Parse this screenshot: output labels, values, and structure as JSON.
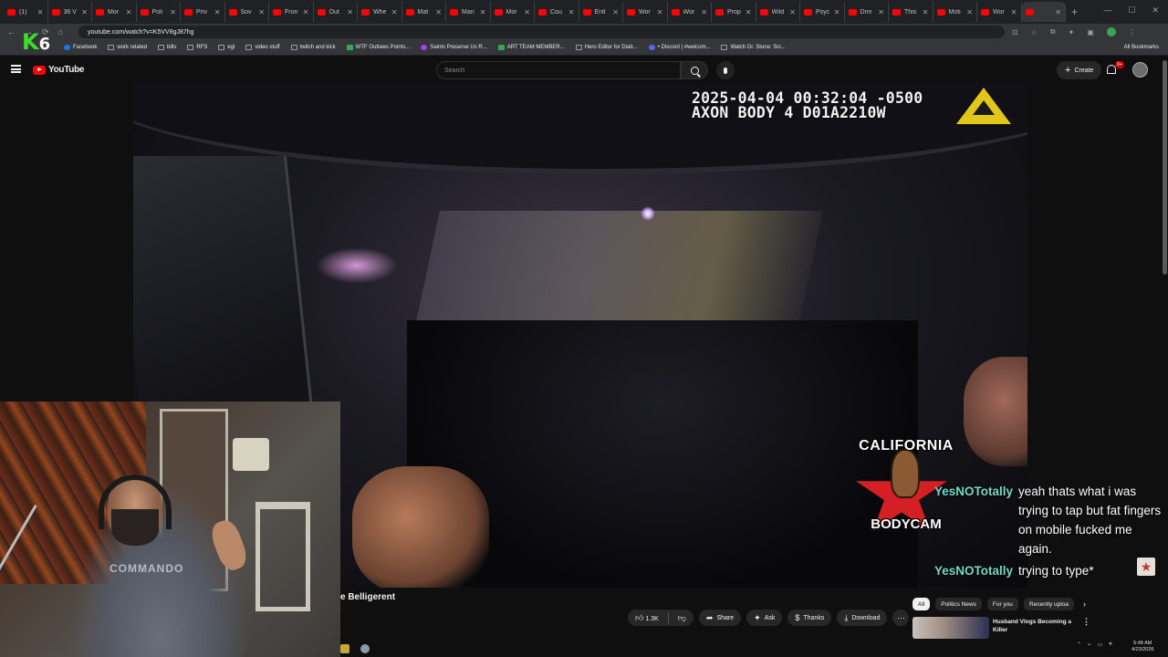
{
  "browser": {
    "tabs": [
      "(1)",
      "36 V",
      "Mor",
      "Poli",
      "Priv",
      "Sov",
      "Fron",
      "Out",
      "Whe",
      "Mat",
      "Man",
      "Mor",
      "Cou",
      "Entl",
      "Wor",
      "Wor",
      "Prop",
      "Wild",
      "Psyc",
      "Drin",
      "This",
      "Moti",
      "Wor"
    ],
    "active_tab": "",
    "url": "youtube.com/watch?v=K5VV8gJ87hg",
    "bookmarks": [
      "Facebook",
      "work related",
      "bills",
      "RFS",
      "egl",
      "video stuff",
      "twitch and kick",
      "WTF Outlaws Points...",
      "Saints Preserve Us R...",
      "ART TEAM MEMBER...",
      "Hero Editor for Diab...",
      "• Discord | #welcom...",
      "Watch Dr. Stone: Sci..."
    ],
    "all_bookmarks": "All Bookmarks"
  },
  "stream_logo": {
    "k": "K",
    "num": "6"
  },
  "youtube": {
    "logo_text": "YouTube",
    "search_placeholder": "Search",
    "create_label": "Create",
    "notif_count": "9+"
  },
  "video": {
    "timestamp": "2025-04-04 00:32:04 -0500",
    "device": "AXON BODY 4 D01A2210W",
    "title": "e Belligerent",
    "like_count": "1.3K",
    "actions": [
      "Share",
      "Ask",
      "Thanks",
      "Download"
    ]
  },
  "overlay_badge": {
    "top": "CALIFORNIA",
    "bottom": "BODYCAM"
  },
  "chat": [
    {
      "user": "YesNOTotally",
      "msg": "yeah thats what i was trying to tap but fat fingers on mobile fucked me again."
    },
    {
      "user": "YesNOTotally",
      "msg": "trying to type*"
    }
  ],
  "webcam": {
    "shirt_text": "COMMANDO"
  },
  "sidebar": {
    "chips": [
      "All",
      "Politics News",
      "For you",
      "Recently uploa"
    ],
    "rec_title": "Husband Vlogs Becoming a Killer"
  },
  "taskbar": {
    "time": "5:48 AM",
    "date": "4/23/2026"
  },
  "colors": {
    "chat_user": "#74d8c4",
    "yt_red": "#ff0000",
    "logo_green": "#3ddc2e"
  }
}
